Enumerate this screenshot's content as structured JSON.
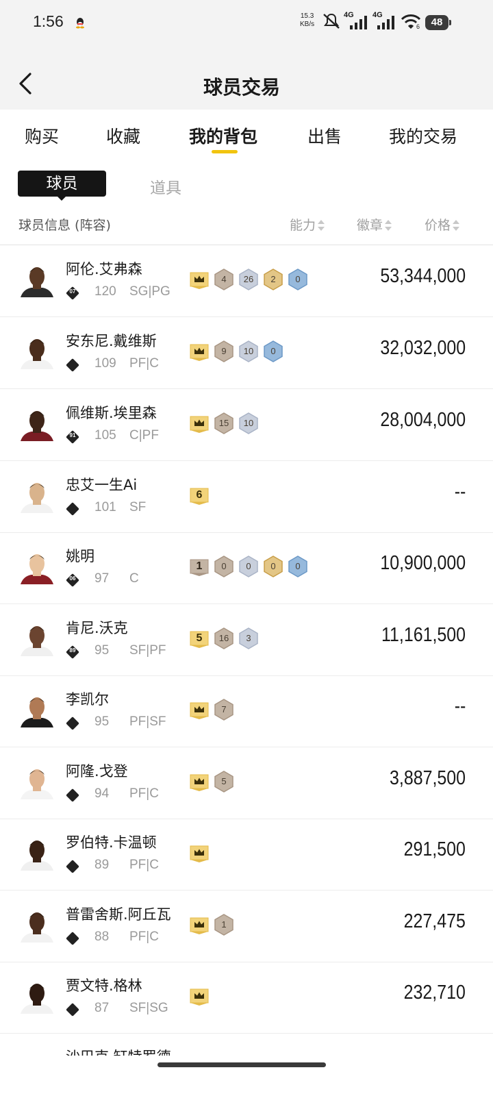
{
  "status_bar": {
    "time": "1:56",
    "net_speed_value": "15.3",
    "net_speed_unit": "KB/s",
    "signal1_label": "4G",
    "signal2_label": "4G",
    "wifi_label": "6",
    "battery": "48",
    "icons": [
      "qq-icon",
      "mute-icon",
      "signal-icon",
      "wifi-icon",
      "battery-icon"
    ]
  },
  "nav": {
    "title": "球员交易",
    "back_icon": "chevron-left-icon"
  },
  "tabs": [
    {
      "label": "购买"
    },
    {
      "label": "收藏"
    },
    {
      "label": "我的背包",
      "active": true
    },
    {
      "label": "出售"
    },
    {
      "label": "我的交易"
    }
  ],
  "segments": {
    "active": "球员",
    "inactive": "道具"
  },
  "columns": {
    "info": "球员信息 (阵容)",
    "ability": "能力",
    "badges": "徽章",
    "price": "价格"
  },
  "colors": {
    "accent_yellow": "#f1c40f",
    "crown_badge": "#efd27a",
    "bronze_badge": "#b8a898",
    "silver_badge": "#b9c2d3",
    "gold_badge": "#d7b56b",
    "blue_badge": "#7fa8d2"
  },
  "players": [
    {
      "name": "阿伦.艾弗森",
      "badge": "07",
      "rating": "120",
      "position": "SG|PG",
      "tiers": [
        {
          "type": "crown",
          "text": ""
        },
        {
          "type": "bronze",
          "text": "4"
        },
        {
          "type": "silver",
          "text": "26"
        },
        {
          "type": "gold",
          "text": "2"
        },
        {
          "type": "blue",
          "text": "0"
        }
      ],
      "price": "53,344,000"
    },
    {
      "name": "安东尼.戴维斯",
      "badge": "",
      "rating": "109",
      "position": "PF|C",
      "tiers": [
        {
          "type": "crown",
          "text": ""
        },
        {
          "type": "bronze",
          "text": "9"
        },
        {
          "type": "silver",
          "text": "10"
        },
        {
          "type": "blue",
          "text": "0"
        }
      ],
      "price": "32,032,000"
    },
    {
      "name": "佩维斯.埃里森",
      "badge": "91",
      "rating": "105",
      "position": "C|PF",
      "tiers": [
        {
          "type": "crown",
          "text": ""
        },
        {
          "type": "bronze",
          "text": "15"
        },
        {
          "type": "silver",
          "text": "10"
        }
      ],
      "price": "28,004,000"
    },
    {
      "name": "忠艾一生Ai",
      "badge": "",
      "rating": "101",
      "position": "SF",
      "tiers": [
        {
          "type": "crown",
          "text": "6"
        }
      ],
      "price": "--"
    },
    {
      "name": "姚明",
      "badge": "06",
      "rating": "97",
      "position": "C",
      "tiers": [
        {
          "type": "bronze-num",
          "text": "1"
        },
        {
          "type": "bronze",
          "text": "0"
        },
        {
          "type": "silver",
          "text": "0"
        },
        {
          "type": "gold",
          "text": "0"
        },
        {
          "type": "blue",
          "text": "0"
        }
      ],
      "price": "10,900,000"
    },
    {
      "name": "肯尼.沃克",
      "badge": "89",
      "rating": "95",
      "position": "SF|PF",
      "tiers": [
        {
          "type": "crown",
          "text": "5"
        },
        {
          "type": "bronze",
          "text": "16"
        },
        {
          "type": "silver",
          "text": "3"
        }
      ],
      "price": "11,161,500"
    },
    {
      "name": "李凯尔",
      "badge": "",
      "rating": "95",
      "position": "PF|SF",
      "tiers": [
        {
          "type": "crown",
          "text": ""
        },
        {
          "type": "bronze",
          "text": "7"
        }
      ],
      "price": "--"
    },
    {
      "name": "阿隆.戈登",
      "badge": "",
      "rating": "94",
      "position": "PF|C",
      "tiers": [
        {
          "type": "crown",
          "text": ""
        },
        {
          "type": "bronze",
          "text": "5"
        }
      ],
      "price": "3,887,500"
    },
    {
      "name": "罗伯特.卡温顿",
      "badge": "",
      "rating": "89",
      "position": "PF|C",
      "tiers": [
        {
          "type": "crown",
          "text": ""
        }
      ],
      "price": "291,500"
    },
    {
      "name": "普雷舍斯.阿丘瓦",
      "badge": "",
      "rating": "88",
      "position": "PF|C",
      "tiers": [
        {
          "type": "crown",
          "text": ""
        },
        {
          "type": "bronze",
          "text": "1"
        }
      ],
      "price": "227,475"
    },
    {
      "name": "贾文特.格林",
      "badge": "",
      "rating": "87",
      "position": "SF|SG",
      "tiers": [
        {
          "type": "crown",
          "text": ""
        }
      ],
      "price": "232,710"
    }
  ],
  "partial_row_name": "沙巴克.缸特罗德"
}
